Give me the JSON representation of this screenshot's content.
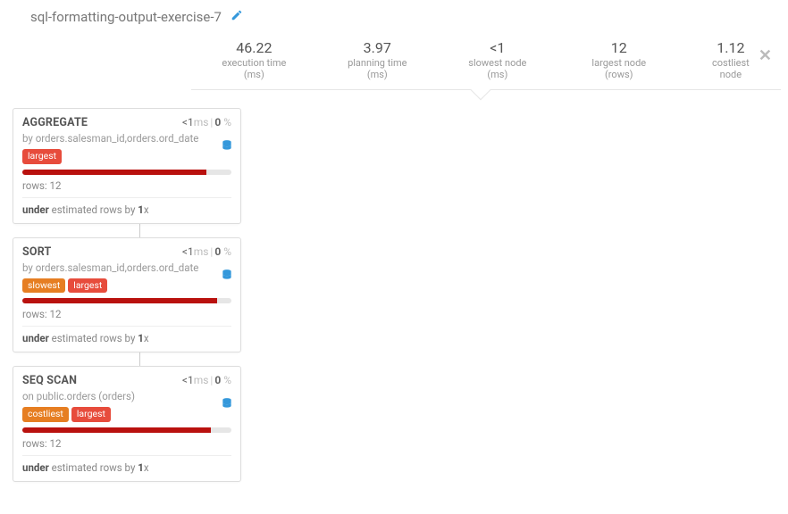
{
  "header": {
    "title": "sql-formatting-output-exercise-7"
  },
  "stats": {
    "execution_time": {
      "value": "46.22",
      "label": "execution time (ms)"
    },
    "planning_time": {
      "value": "3.97",
      "label": "planning time (ms)"
    },
    "slowest_node": {
      "value": "<1",
      "label": "slowest node (ms)"
    },
    "largest_node": {
      "value": "12",
      "label": "largest node (rows)"
    },
    "costliest_node": {
      "value": "1.12",
      "label": "costliest node"
    }
  },
  "nodes": [
    {
      "title": "AGGREGATE",
      "time": "<1",
      "time_unit": "ms",
      "pct": "0",
      "sub_prefix": "by ",
      "sub": "orders.salesman_id,orders.ord_date",
      "tags": [
        "largest"
      ],
      "tag_colors": [
        "red"
      ],
      "bar_pct": 88,
      "rows": "12",
      "estimate_word": "under",
      "estimate_x": "1"
    },
    {
      "title": "SORT",
      "time": "<1",
      "time_unit": "ms",
      "pct": "0",
      "sub_prefix": "by ",
      "sub": "orders.salesman_id,orders.ord_date",
      "tags": [
        "slowest",
        "largest"
      ],
      "tag_colors": [
        "orange",
        "red"
      ],
      "bar_pct": 93,
      "rows": "12",
      "estimate_word": "under",
      "estimate_x": "1"
    },
    {
      "title": "SEQ SCAN",
      "time": "<1",
      "time_unit": "ms",
      "pct": "0",
      "sub_prefix": "on ",
      "sub": "public.orders (orders)",
      "tags": [
        "costliest",
        "largest"
      ],
      "tag_colors": [
        "orange",
        "red"
      ],
      "bar_pct": 90,
      "rows": "12",
      "estimate_word": "under",
      "estimate_x": "1"
    }
  ],
  "labels": {
    "rows_prefix": "rows: ",
    "estimate_mid": " estimated rows by ",
    "x_suffix": "x",
    "pct_suffix": " %"
  }
}
